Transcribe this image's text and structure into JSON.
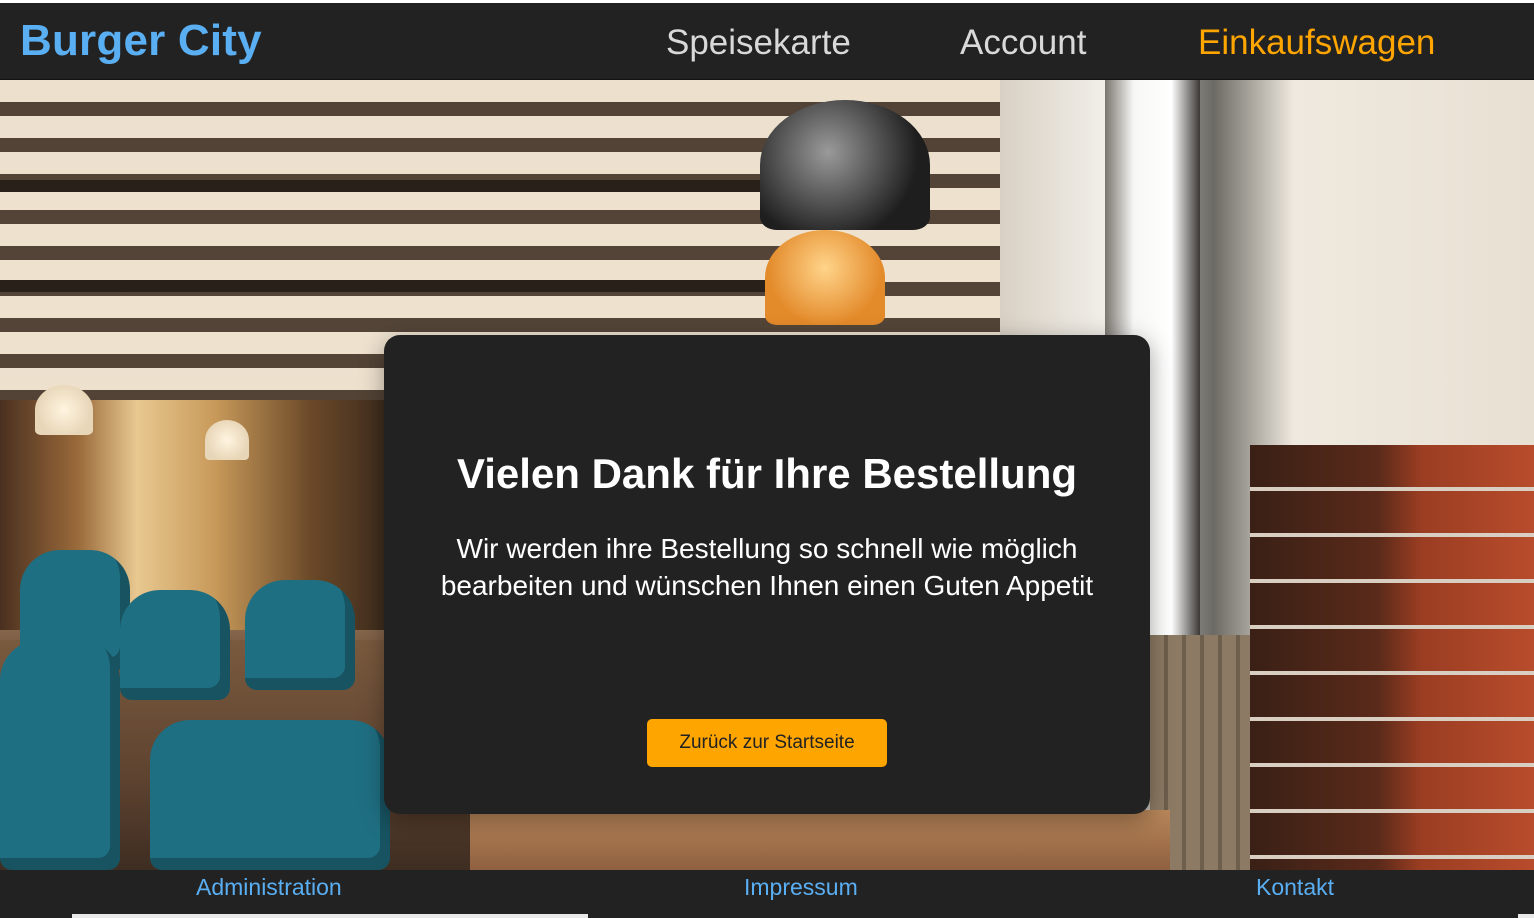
{
  "header": {
    "brand": "Burger City",
    "nav": {
      "menu": "Speisekarte",
      "account": "Account",
      "cart": "Einkaufswagen"
    }
  },
  "confirmation": {
    "title": "Vielen Dank für Ihre Bestellung",
    "message": "Wir werden ihre Bestellung so schnell wie möglich bearbeiten und wünschen Ihnen einen Guten Appetit",
    "back_button": "Zurück zur Startseite"
  },
  "footer": {
    "administration": "Administration",
    "imprint": "Impressum",
    "contact": "Kontakt"
  },
  "colors": {
    "header_bg": "#222222",
    "brand": "#5aaef2",
    "accent": "#ffa500",
    "card_bg": "#222222"
  }
}
